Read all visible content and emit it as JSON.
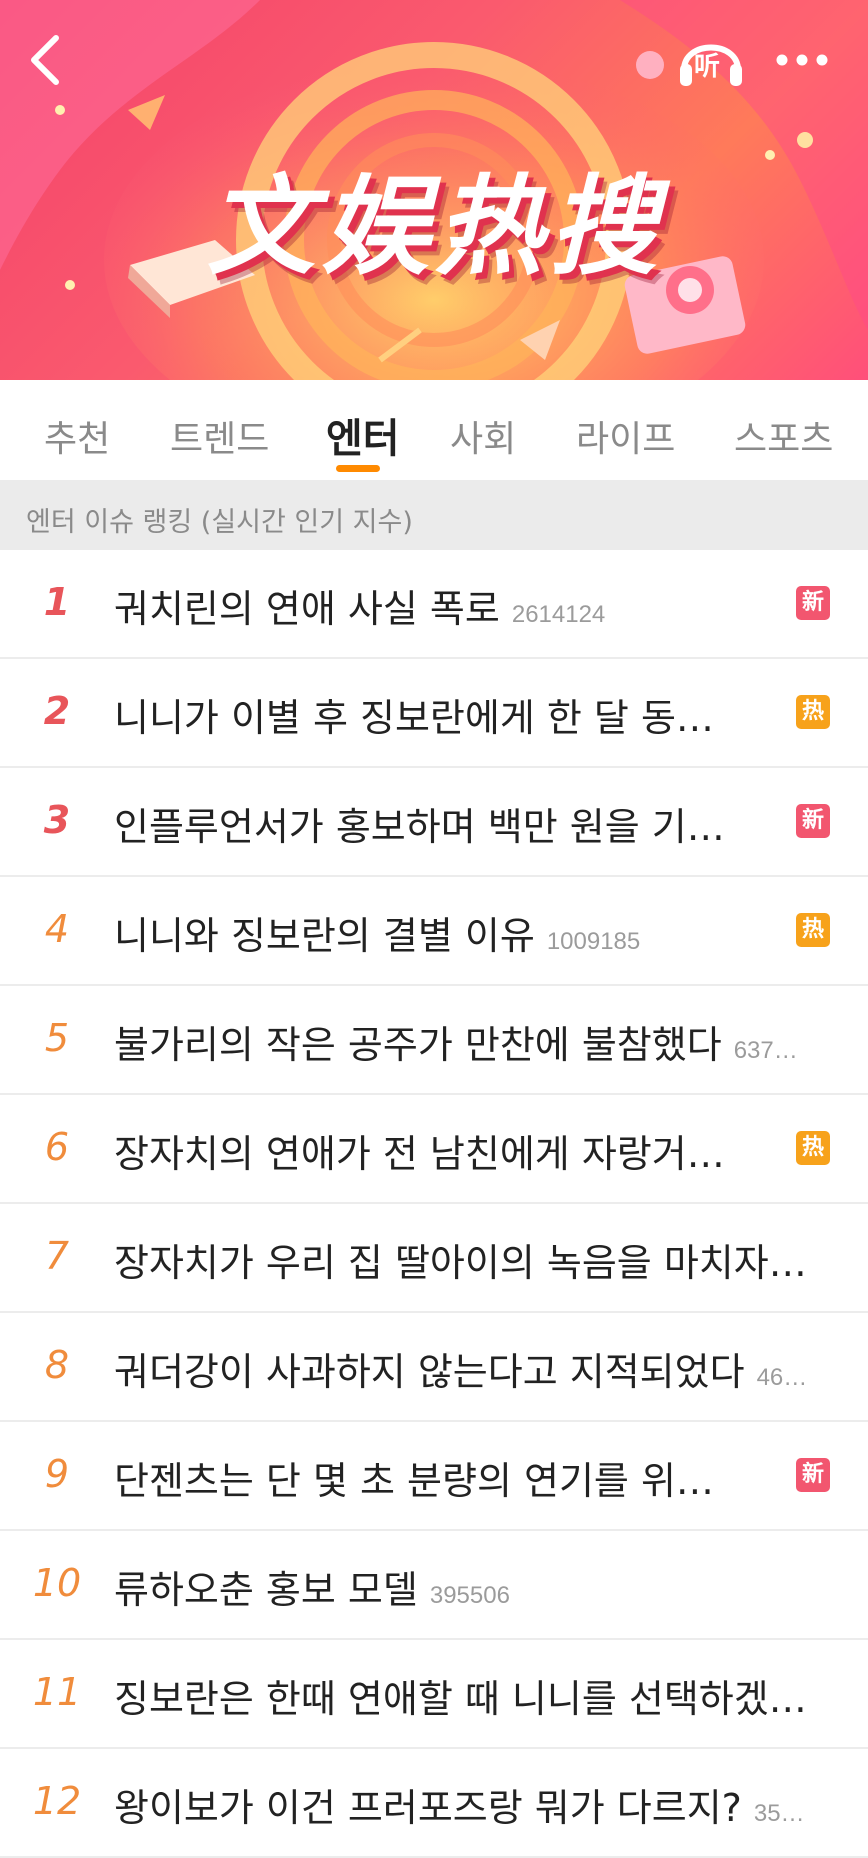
{
  "header": {
    "back_icon": "chevron-left-icon",
    "listen_label": "听",
    "listen_icon": "headphones-icon",
    "more_icon": "more-dots-icon",
    "banner_title": "文娱热搜"
  },
  "tabs": [
    {
      "label": "추천",
      "active": false
    },
    {
      "label": "트렌드",
      "active": false
    },
    {
      "label": "엔터",
      "active": true
    },
    {
      "label": "사회",
      "active": false
    },
    {
      "label": "라이프",
      "active": false
    },
    {
      "label": "스포츠",
      "active": false
    }
  ],
  "section": {
    "title": "엔터 이슈 랭킹 (실시간 인기 지수)"
  },
  "colors": {
    "accent_underline": "#ff8a00",
    "badge_new": "#f2566f",
    "badge_hot": "#f7a21b",
    "rank_top": "#e8555a",
    "rank_mid": "#f08c3c"
  },
  "items": [
    {
      "rank": "1",
      "title": "궈치린의 연애 사실 폭로",
      "count": "2614124",
      "badge": "新",
      "badge_type": "new"
    },
    {
      "rank": "2",
      "title": "니니가 이별 후 징보란에게 한 달 동…",
      "count": "",
      "badge": "热",
      "badge_type": "hot"
    },
    {
      "rank": "3",
      "title": "인플루언서가 홍보하며 백만 원을 기…",
      "count": "",
      "badge": "新",
      "badge_type": "new"
    },
    {
      "rank": "4",
      "title": "니니와 징보란의 결별 이유",
      "count": "1009185",
      "badge": "热",
      "badge_type": "hot"
    },
    {
      "rank": "5",
      "title": "불가리의 작은 공주가 만찬에 불참했다",
      "count": "637…",
      "badge": "",
      "badge_type": ""
    },
    {
      "rank": "6",
      "title": "장자치의 연애가 전 남친에게 자랑거…",
      "count": "",
      "badge": "热",
      "badge_type": "hot"
    },
    {
      "rank": "7",
      "title": "장자치가 우리 집 딸아이의 녹음을 마치자…",
      "count": "",
      "badge": "",
      "badge_type": ""
    },
    {
      "rank": "8",
      "title": "궈더강이 사과하지 않는다고 지적되었다",
      "count": "46…",
      "badge": "",
      "badge_type": ""
    },
    {
      "rank": "9",
      "title": "단젠츠는 단 몇 초 분량의 연기를 위…",
      "count": "",
      "badge": "新",
      "badge_type": "new"
    },
    {
      "rank": "10",
      "title": "류하오춘 홍보 모델",
      "count": "395506",
      "badge": "",
      "badge_type": ""
    },
    {
      "rank": "11",
      "title": "징보란은 한때 연애할 때 니니를 선택하겠…",
      "count": "",
      "badge": "",
      "badge_type": ""
    },
    {
      "rank": "12",
      "title": "왕이보가 이건 프러포즈랑 뭐가 다르지?",
      "count": "35…",
      "badge": "",
      "badge_type": ""
    }
  ]
}
